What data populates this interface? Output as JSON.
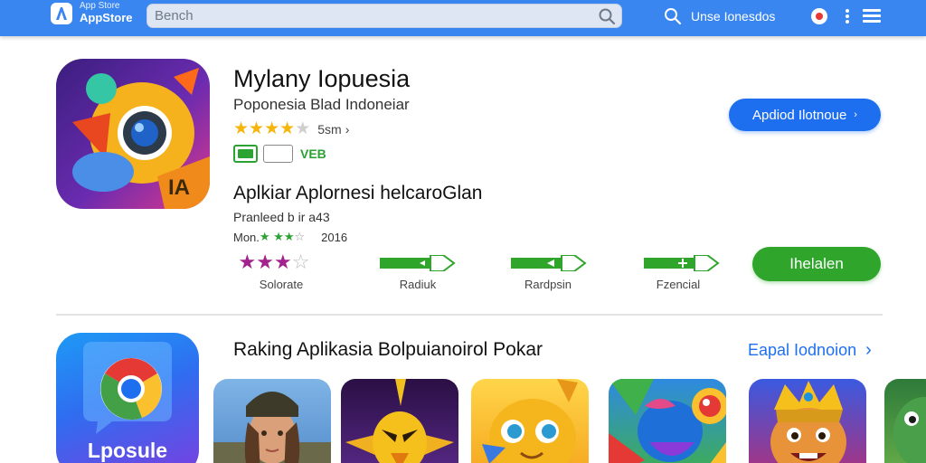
{
  "header": {
    "logo_line1": "App Store",
    "logo_line2": "AppStore",
    "search_placeholder": "Bench",
    "nav_link": "Unse Ionesdos"
  },
  "app": {
    "title": "Mylany Iopuesia",
    "developer": "Poponesia Blad Indoneiar",
    "rating_stars": 4,
    "rating_count": "5sm",
    "badge_text": "VEB",
    "primary_button": "Apdiod Ilotnoue",
    "primary_button_arrow": "›"
  },
  "details": {
    "heading": "Aplkiar Aplornesi helcaroGlan",
    "meta1": "Pranleed b ir a43",
    "meta2_label": "Mon.",
    "meta2_stars": 3,
    "meta2_year": "2016",
    "stat_stars": 3,
    "stats": [
      {
        "label": "Solorate"
      },
      {
        "label": "Radiuk"
      },
      {
        "label": "Rardpsin"
      },
      {
        "label": "Fzencial"
      }
    ],
    "install_button": "Ihelalen"
  },
  "ranking": {
    "title": "Raking Aplikasia Bolpuianoirol Pokar",
    "see_all": "Eapal Iodnoion",
    "see_all_chevron": "›",
    "featured_label": "Lposule",
    "tiles": [
      {
        "icon": "soldier-portrait-icon",
        "color": "#6fa2d8"
      },
      {
        "icon": "purple-bird-character-icon",
        "color": "#3b1a5c"
      },
      {
        "icon": "yellow-chick-character-icon",
        "color": "#f5b51c"
      },
      {
        "icon": "colorful-parrot-icon",
        "color": "#2b7ad8"
      },
      {
        "icon": "golden-king-character-icon",
        "color": "#7a3a8a"
      },
      {
        "icon": "green-dino-character-icon",
        "color": "#3b8a3a"
      }
    ]
  },
  "colors": {
    "topbar": "#3a86f0",
    "primary": "#1e6ff0",
    "install": "#2fa62b",
    "star": "#f5b50a",
    "purple_star": "#a3228e"
  }
}
